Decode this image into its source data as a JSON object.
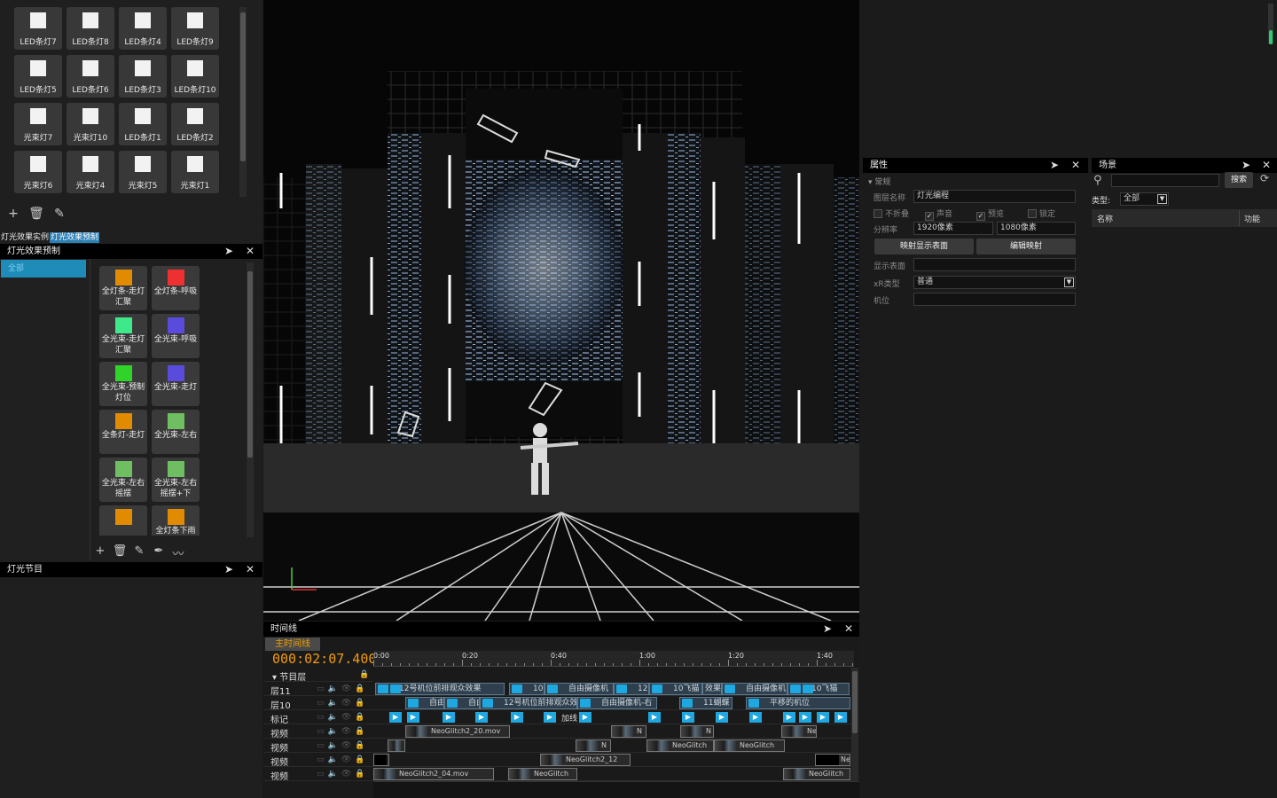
{
  "led_tiles": [
    {
      "label": "LED条灯7"
    },
    {
      "label": "LED条灯8"
    },
    {
      "label": "LED条灯4"
    },
    {
      "label": "LED条灯9"
    },
    {
      "label": "LED条灯5"
    },
    {
      "label": "LED条灯6"
    },
    {
      "label": "LED条灯3"
    },
    {
      "label": "LED条灯10"
    },
    {
      "label": "光束灯7"
    },
    {
      "label": "光束灯10"
    },
    {
      "label": "LED条灯1"
    },
    {
      "label": "LED条灯2"
    },
    {
      "label": "光束灯6"
    },
    {
      "label": "光束灯4"
    },
    {
      "label": "光束灯5"
    },
    {
      "label": "光束灯1"
    }
  ],
  "left_tabs": {
    "tab1": "灯光效果实例",
    "tab2": "灯光效果预制"
  },
  "preset_panel": {
    "title": "灯光效果预制",
    "category": "全部",
    "presets": [
      {
        "label": "全灯条-走灯汇聚",
        "color": "#e08b00"
      },
      {
        "label": "全灯条-呼吸",
        "color": "#ee3030"
      },
      {
        "label": "全光束-走灯汇聚",
        "color": "#3fe88a"
      },
      {
        "label": "全光束-呼吸",
        "color": "#5a4bdc"
      },
      {
        "label": "全光束-预制灯位",
        "color": "#30d32a"
      },
      {
        "label": "全光束-走灯",
        "color": "#5a4bdc"
      },
      {
        "label": "全条灯-走灯",
        "color": "#e08b00"
      },
      {
        "label": "全光束-左右",
        "color": "#6fbf62"
      },
      {
        "label": "全光束-左右摇摆",
        "color": "#6fbf62"
      },
      {
        "label": "全光束-左右摇摆+下",
        "color": "#6fbf62"
      },
      {
        "label": "",
        "color": "#e08b00"
      },
      {
        "label": "全灯条下雨",
        "color": "#e08b00"
      }
    ]
  },
  "program_panel": {
    "title": "灯光节目"
  },
  "timeline": {
    "title": "时间线",
    "main_tab": "主时间线",
    "timecode": "000:02:07.400",
    "ruler": [
      "0:00",
      "0:20",
      "0:40",
      "1:00",
      "1:20",
      "1:40"
    ],
    "group": "节目层",
    "tracks": [
      "层11",
      "层10",
      "标记",
      "视频",
      "视频",
      "视频",
      "视频"
    ],
    "layer11_clips": [
      "12号机位前排观众效果",
      "10",
      "自由摄像机",
      "12号",
      "10飞猫",
      "效果",
      "自由摄像机",
      "10飞猫"
    ],
    "layer10_clips": [
      "自由",
      "自由",
      "12号机位前排观众效果",
      "自由摄像机-右",
      "11蝴蝶",
      "平移的机位"
    ],
    "mark_label": "加线",
    "video_clips": {
      "v1": [
        "NeoGlitch2_20.mov",
        "N",
        "N",
        "Ne"
      ],
      "v2": [
        "",
        "N",
        "NeoGlitch",
        "NeoGlitch"
      ],
      "v3": [
        "NeoGlitch2_12",
        "Ne"
      ],
      "v4": [
        "NeoGlitch2_04.mov",
        "NeoGlitch",
        "NeoGlitch"
      ]
    }
  },
  "props": {
    "title": "属性",
    "section": "常规",
    "layer_name_label": "图层名称",
    "layer_name": "灯光编程",
    "cb_fold": "不折叠",
    "cb_sound": "声音",
    "cb_preview": "预览",
    "cb_lock": "锁定",
    "res_label": "分辨率",
    "res_w": "1920像素",
    "res_h": "1080像素",
    "btn_map": "映射显示表面",
    "btn_edit": "编辑映射",
    "surface_label": "显示表面",
    "xr_label": "xR类型",
    "xr_value": "普通",
    "camera_label": "机位"
  },
  "scene": {
    "title": "场景",
    "search_btn": "搜索",
    "type_label": "类型:",
    "type_value": "全部",
    "col_name": "名称",
    "col_func": "功能"
  }
}
